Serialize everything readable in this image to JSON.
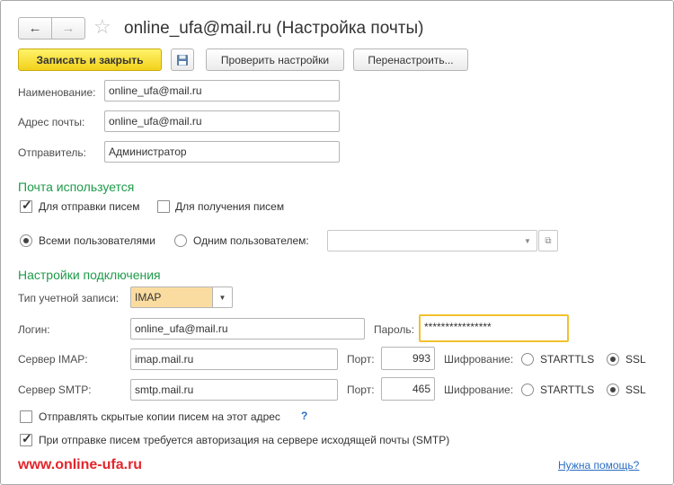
{
  "window": {
    "title": "online_ufa@mail.ru (Настройка почты)"
  },
  "toolbar": {
    "save_close_label": "Записать и закрыть",
    "check_label": "Проверить настройки",
    "reconfigure_label": "Перенастроить..."
  },
  "fields": {
    "name_label": "Наименование:",
    "name_value": "online_ufa@mail.ru",
    "address_label": "Адрес почты:",
    "address_value": "online_ufa@mail.ru",
    "sender_label": "Отправитель:",
    "sender_value": "Администратор"
  },
  "usage": {
    "header": "Почта используется",
    "send_label": "Для отправки писем",
    "send_checked": true,
    "receive_label": "Для получения писем",
    "receive_checked": false,
    "all_users_label": "Всеми пользователями",
    "one_user_label": "Одним пользователем:",
    "selected": "all_users"
  },
  "connection": {
    "header": "Настройки подключения",
    "type_label": "Тип учетной записи:",
    "type_value": "IMAP",
    "login_label": "Логин:",
    "login_value": "online_ufa@mail.ru",
    "password_label": "Пароль:",
    "password_value": "****************",
    "imap_label": "Сервер IMAP:",
    "imap_value": "imap.mail.ru",
    "imap_port_label": "Порт:",
    "imap_port_value": "993",
    "imap_enc_label": "Шифрование:",
    "smtp_label": "Сервер SMTP:",
    "smtp_value": "smtp.mail.ru",
    "smtp_port_label": "Порт:",
    "smtp_port_value": "465",
    "smtp_enc_label": "Шифрование:",
    "starttls_label": "STARTTLS",
    "ssl_label": "SSL",
    "imap_encryption": "SSL",
    "smtp_encryption": "SSL"
  },
  "options": {
    "bcc_label": "Отправлять скрытые копии писем на этот адрес",
    "bcc_checked": false,
    "bcc_help": "?",
    "smtp_auth_label": "При отправке писем требуется авторизация на сервере исходящей почты (SMTP)",
    "smtp_auth_checked": true
  },
  "footer": {
    "watermark": "www.online-ufa.ru",
    "help_link": "Нужна помощь?"
  },
  "colors": {
    "section_header": "#1e9b4a",
    "primary_button": "#f2d11a",
    "account_type_bg": "#fbdca0",
    "password_border": "#f2c12e",
    "watermark": "#e3262c",
    "link": "#2a6ec4"
  },
  "icons": {
    "back": "arrow-left-icon",
    "forward": "arrow-right-icon",
    "favorite": "star-icon",
    "save": "floppy-disk-icon",
    "dropdown": "chevron-down-icon",
    "open": "open-window-icon"
  }
}
